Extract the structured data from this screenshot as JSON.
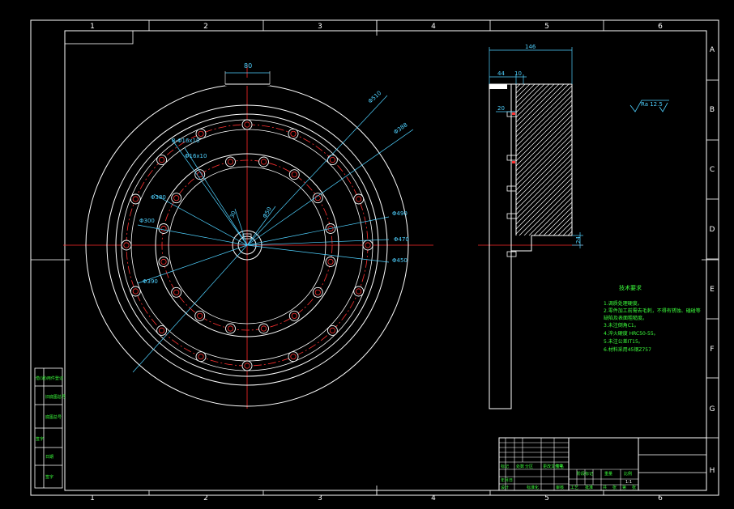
{
  "grid": {
    "columns": [
      "1",
      "2",
      "3",
      "4",
      "5",
      "6"
    ],
    "rows": [
      "A",
      "B",
      "C",
      "D",
      "E",
      "F",
      "G",
      "H"
    ]
  },
  "front_view": {
    "top_dimension": "80",
    "bolt_circle_labels": {
      "small_holes": "8-Φ16x10",
      "small_holes_2": "Φ16x10",
      "key_width": "30",
      "bore": "Φ50"
    },
    "diameters": [
      "Φ510",
      "Φ388",
      "Φ380",
      "Φ300",
      "Φ390",
      "Φ490",
      "Φ470",
      "Φ450"
    ]
  },
  "side_view": {
    "overall_width": "146",
    "dim_left": "44",
    "dim_right": "10",
    "dim_slot": "20",
    "dim_step": "24"
  },
  "surface_finish": {
    "value": "Ra 12.5"
  },
  "technical_notes": {
    "title": "技术要求",
    "lines": [
      "1.调质处理硬度。",
      "2.零件加工前需去毛刺，不得有锈蚀、磕碰等",
      "  缺陷及表面粗糙度。",
      "3.未注倒角C1。",
      "4.淬火硬度  HRC50-55。",
      "5.未注公差IT15。",
      "6.材料采用45钢Z757"
    ]
  },
  "left_panel": {
    "labels": [
      "借(通)用件登记",
      "旧底图总号",
      "底图总号",
      "签字",
      "日期",
      "签字"
    ]
  },
  "title_block": {
    "cells": [
      "标记",
      "处数",
      "分区",
      "更改文件号",
      "签名",
      "年月日",
      "设计",
      "标准化",
      "阶段标记",
      "重量",
      "比例",
      "审核",
      "工艺",
      "批准",
      "共",
      "张",
      "第",
      "张",
      "1:1"
    ]
  }
}
